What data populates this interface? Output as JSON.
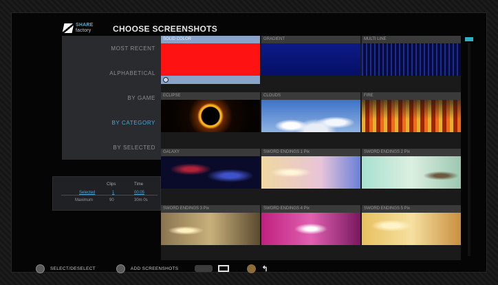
{
  "header": {
    "logo_line1": "SHARE",
    "logo_line2": "factory",
    "title": "CHOOSE SCREENSHOTS"
  },
  "sort_options": [
    {
      "label": "MOST RECENT",
      "active": false
    },
    {
      "label": "ALPHABETICAL",
      "active": false
    },
    {
      "label": "BY GAME",
      "active": false
    },
    {
      "label": "BY CATEGORY",
      "active": true
    },
    {
      "label": "BY SELECTED",
      "active": false
    }
  ],
  "stats": {
    "col_clips": "Clips",
    "col_time": "Time",
    "row1_label": "Selected",
    "row1_clips": "1",
    "row1_time": "00:05",
    "row2_label": "Maximum",
    "row2_clips": "90",
    "row2_time": "30m 0s"
  },
  "tiles": [
    {
      "label": "SOLID COLOR",
      "selected": true,
      "visual": "solid-red"
    },
    {
      "label": "GRADIENT",
      "selected": false,
      "visual": "gradient-blue"
    },
    {
      "label": "MULTI LINE",
      "selected": false,
      "visual": "lines-blue"
    },
    {
      "label": "ECLIPSE",
      "selected": false,
      "visual": "eclipse"
    },
    {
      "label": "CLOUDS",
      "selected": false,
      "visual": "clouds"
    },
    {
      "label": "FIRE",
      "selected": false,
      "visual": "fire"
    },
    {
      "label": "GALAXY",
      "selected": false,
      "visual": "galaxy"
    },
    {
      "label": "SWORD ENDINGS 1 Pix",
      "selected": false,
      "visual": "anime1"
    },
    {
      "label": "SWORD ENDINGS 2 Pix",
      "selected": false,
      "visual": "anime2"
    },
    {
      "label": "SWORD ENDINGS 3 Pix",
      "selected": false,
      "visual": "anime3"
    },
    {
      "label": "SWORD ENDINGS 4 Pix",
      "selected": false,
      "visual": "anime4"
    },
    {
      "label": "SWORD ENDINGS 5 Pix",
      "selected": false,
      "visual": "anime5"
    }
  ],
  "bottom_bar": {
    "select_label": "SELECT/DESELECT",
    "add_label": "ADD SCREENSHOTS"
  },
  "colors": {
    "accent": "#4aa7d8",
    "selected_tile": "#8aa3c8",
    "scroll_thumb": "#2bb3c2"
  }
}
